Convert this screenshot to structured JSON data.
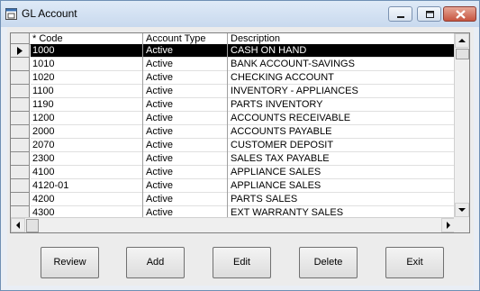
{
  "window": {
    "title": "GL Account"
  },
  "grid": {
    "columns": [
      "* Code",
      "Account Type",
      "Description"
    ],
    "rows": [
      {
        "code": "1000",
        "type": "Active",
        "description": "CASH ON HAND",
        "selected": true
      },
      {
        "code": "1010",
        "type": "Active",
        "description": "BANK ACCOUNT-SAVINGS"
      },
      {
        "code": "1020",
        "type": "Active",
        "description": "CHECKING ACCOUNT"
      },
      {
        "code": "1100",
        "type": "Active",
        "description": "INVENTORY - APPLIANCES"
      },
      {
        "code": "1190",
        "type": "Active",
        "description": "PARTS INVENTORY"
      },
      {
        "code": "1200",
        "type": "Active",
        "description": "ACCOUNTS RECEIVABLE"
      },
      {
        "code": "2000",
        "type": "Active",
        "description": "ACCOUNTS PAYABLE"
      },
      {
        "code": "2070",
        "type": "Active",
        "description": "CUSTOMER DEPOSIT"
      },
      {
        "code": "2300",
        "type": "Active",
        "description": "SALES TAX PAYABLE"
      },
      {
        "code": "4100",
        "type": "Active",
        "description": "APPLIANCE SALES"
      },
      {
        "code": "4120-01",
        "type": "Active",
        "description": "APPLIANCE SALES"
      },
      {
        "code": "4200",
        "type": "Active",
        "description": "PARTS SALES"
      },
      {
        "code": "4300",
        "type": "Active",
        "description": "EXT WARRANTY SALES"
      }
    ]
  },
  "buttons": {
    "review": "Review",
    "add": "Add",
    "edit": "Edit",
    "delete": "Delete",
    "exit": "Exit"
  },
  "icons": {
    "app": "window-app-icon",
    "minimize": "minimize-icon",
    "maximize": "maximize-icon",
    "close": "close-icon",
    "row_pointer": "row-pointer-icon"
  },
  "colors": {
    "selection": "#000000",
    "close_button": "#c7553f",
    "titlebar": "#c8d9ee"
  }
}
